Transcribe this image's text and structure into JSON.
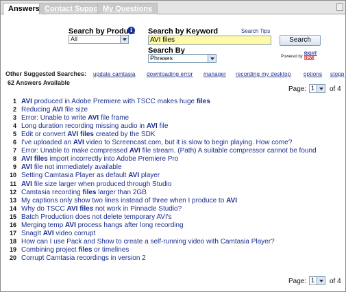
{
  "tabs": [
    {
      "label": "Answers",
      "active": true
    },
    {
      "label": "Contact Support",
      "active": false
    },
    {
      "label": "My Questions",
      "active": false
    }
  ],
  "search": {
    "product_label": "Search by Product",
    "product_value": "All",
    "keyword_label": "Search by Keyword",
    "tips_label": "Search Tips",
    "keyword_value": "AVI files",
    "search_by_label": "Search By",
    "search_by_value": "Phrases",
    "button_label": "Search",
    "powered_by": "Powered by",
    "brand_top": "RIGHT",
    "brand_bottom": "NOW"
  },
  "suggested": {
    "label": "Other Suggested Searches:",
    "items": [
      "update camtasia",
      "downloading error",
      "manager",
      "recording my desktop",
      "options",
      "stopp"
    ]
  },
  "answers_count": "62 Answers Available",
  "pager": {
    "page_label": "Page:",
    "current": "1",
    "of_label": "of 4"
  },
  "results": [
    {
      "n": "1",
      "parts": [
        [
          "AVI",
          true
        ],
        [
          " produced in Adobe Premiere with TSCC makes huge ",
          false
        ],
        [
          "files",
          true
        ]
      ]
    },
    {
      "n": "2",
      "parts": [
        [
          "Reducing ",
          false
        ],
        [
          "AVI",
          true
        ],
        [
          " file size",
          false
        ]
      ]
    },
    {
      "n": "3",
      "parts": [
        [
          "Error: Unable to write ",
          false
        ],
        [
          "AVI",
          true
        ],
        [
          " file frame",
          false
        ]
      ]
    },
    {
      "n": "4",
      "parts": [
        [
          "Long duration recording missing audio in ",
          false
        ],
        [
          "AVI",
          true
        ],
        [
          " file",
          false
        ]
      ]
    },
    {
      "n": "5",
      "parts": [
        [
          "Edit or convert ",
          false
        ],
        [
          "AVI files",
          true
        ],
        [
          " created by the SDK",
          false
        ]
      ]
    },
    {
      "n": "6",
      "parts": [
        [
          "I've uploaded an ",
          false
        ],
        [
          "AVI",
          true
        ],
        [
          " video to Screencast.com, but it is slow to begin playing. How come?",
          false
        ]
      ]
    },
    {
      "n": "7",
      "parts": [
        [
          "Error: Unable to make compressed ",
          false
        ],
        [
          "AVI",
          true
        ],
        [
          " file stream. (Path) A suitable compressor cannot be found",
          false
        ]
      ]
    },
    {
      "n": "8",
      "parts": [
        [
          "AVI files",
          true
        ],
        [
          " import incorrectly into Adobe Premiere Pro",
          false
        ]
      ]
    },
    {
      "n": "9",
      "parts": [
        [
          "AVI",
          true
        ],
        [
          " file not immediately available",
          false
        ]
      ]
    },
    {
      "n": "10",
      "parts": [
        [
          "Setting Camtasia Player as default ",
          false
        ],
        [
          "AVI",
          true
        ],
        [
          " player",
          false
        ]
      ]
    },
    {
      "n": "11",
      "parts": [
        [
          "AVI",
          true
        ],
        [
          " file size larger when produced through Studio",
          false
        ]
      ]
    },
    {
      "n": "12",
      "parts": [
        [
          "Camtasia recording ",
          false
        ],
        [
          "files",
          true
        ],
        [
          " larger than 2GB",
          false
        ]
      ]
    },
    {
      "n": "13",
      "parts": [
        [
          "My captions only show two lines instead of three when I produce to ",
          false
        ],
        [
          "AVI",
          true
        ]
      ]
    },
    {
      "n": "14",
      "parts": [
        [
          "Why do TSCC ",
          false
        ],
        [
          "AVI files",
          true
        ],
        [
          " not work in Pinnacle Studio?",
          false
        ]
      ]
    },
    {
      "n": "15",
      "parts": [
        [
          "Batch Production does not delete temporary AVI's",
          false
        ]
      ]
    },
    {
      "n": "16",
      "parts": [
        [
          "Merging temp ",
          false
        ],
        [
          "AVI",
          true
        ],
        [
          " process hangs after long recording",
          false
        ]
      ]
    },
    {
      "n": "17",
      "parts": [
        [
          "SnagIt ",
          false
        ],
        [
          "AVI",
          true
        ],
        [
          " video corrupt",
          false
        ]
      ]
    },
    {
      "n": "18",
      "parts": [
        [
          "How can I use Pack and Show to create a self-running video with Camtasia Player?",
          false
        ]
      ]
    },
    {
      "n": "19",
      "parts": [
        [
          "Combining project ",
          false
        ],
        [
          "files",
          true
        ],
        [
          " or timelines",
          false
        ]
      ]
    },
    {
      "n": "20",
      "parts": [
        [
          "Corrupt Camtasia recordings in version 2",
          false
        ]
      ]
    }
  ]
}
